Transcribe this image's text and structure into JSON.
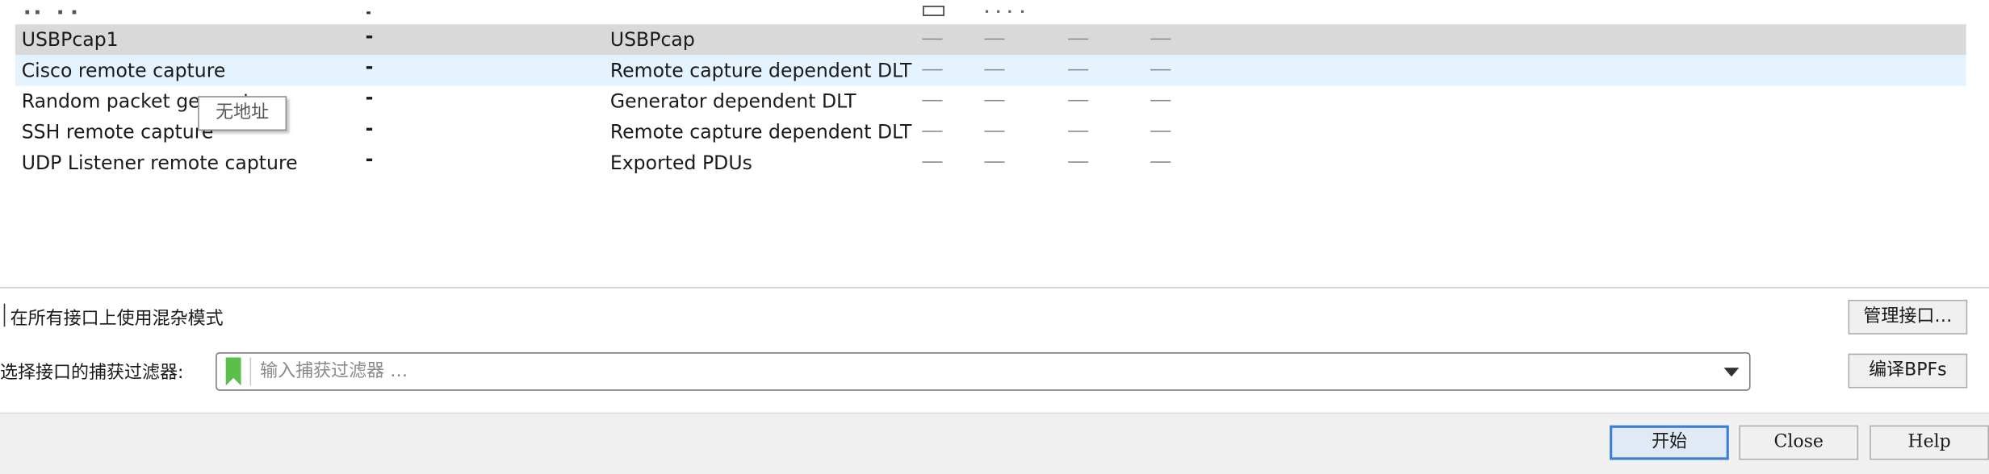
{
  "interfaces": {
    "rows": [
      {
        "name": "USBPcap1",
        "traffic": "-",
        "type": "USBPcap",
        "state": "selected"
      },
      {
        "name": "Cisco remote capture",
        "traffic": "-",
        "type": "Remote capture dependent DLT",
        "state": "hover"
      },
      {
        "name": "Random packet generator",
        "traffic": "-",
        "type": "Generator dependent DLT",
        "state": "normal"
      },
      {
        "name": "SSH remote capture",
        "traffic": "-",
        "type": "Remote capture dependent DLT",
        "state": "normal"
      },
      {
        "name": "UDP Listener remote capture",
        "traffic": "-",
        "type": "Exported PDUs",
        "state": "normal"
      }
    ],
    "empty_value": "—",
    "tooltip": "无地址"
  },
  "options": {
    "promiscuous_label": "在所有接口上使用混杂模式",
    "promiscuous_checked": false,
    "manage_button": "管理接口…",
    "compile_bpf_button": "编译BPFs"
  },
  "filter": {
    "label": "选择接口的捕获过滤器:",
    "placeholder": "输入捕获过滤器 …",
    "value": "",
    "bookmark_color": "#5ac04a"
  },
  "footer": {
    "start_button": "开始",
    "close_button": "Close",
    "help_button": "Help",
    "accent_color": "#3c7fd1"
  }
}
